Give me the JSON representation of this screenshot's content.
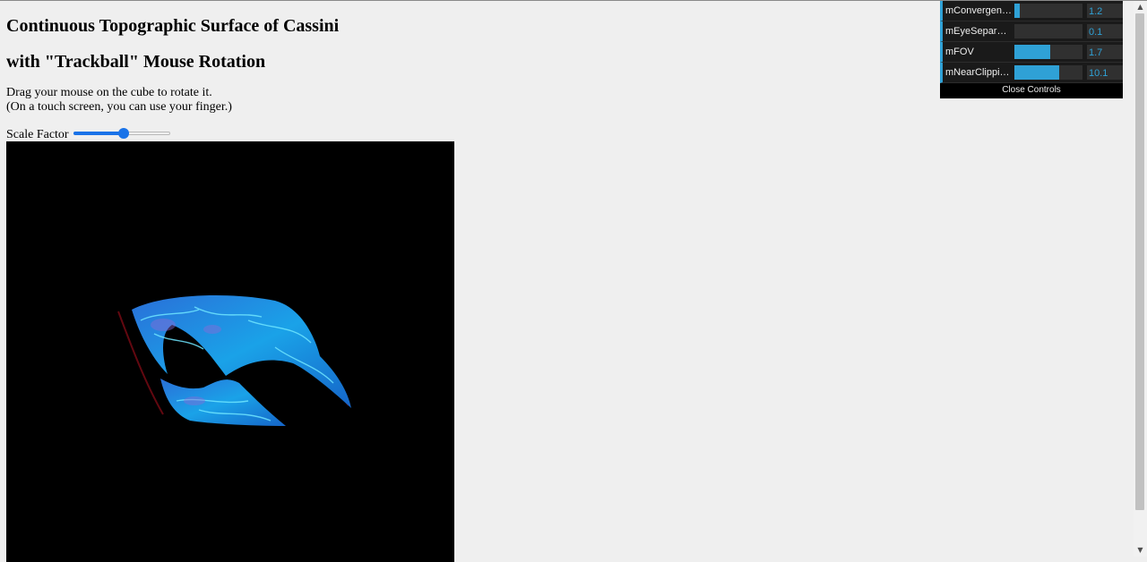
{
  "page": {
    "heading_line1": "Continuous Topographic Surface of Cassini",
    "heading_line2": "with \"Trackball\" Mouse Rotation",
    "instruction_line1": "Drag your mouse on the cube to rotate it.",
    "instruction_line2": "(On a touch screen, you can use your finger.)",
    "scale_label": "Scale Factor",
    "scale_value_fraction": 0.52
  },
  "gui": {
    "controls": [
      {
        "label": "mConvergence",
        "value": "1.2",
        "fraction": 0.08
      },
      {
        "label": "mEyeSeparation",
        "value": "0.1",
        "fraction": 0.0
      },
      {
        "label": "mFOV",
        "value": "1.7",
        "fraction": 0.53
      },
      {
        "label": "mNearClippingD...",
        "value": "10.1",
        "fraction": 0.66
      }
    ],
    "close_label": "Close Controls",
    "accent_color": "#2fa1d6"
  },
  "canvas": {
    "background": "#000000",
    "surface_color": "#1e8fd6"
  },
  "scroll": {
    "arrow_down": "▼"
  }
}
